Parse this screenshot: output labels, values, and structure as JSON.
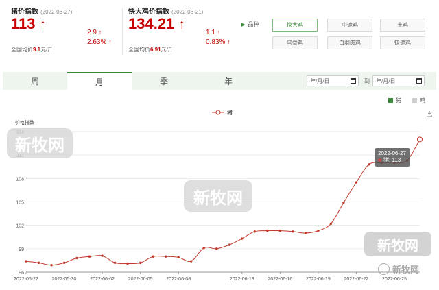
{
  "pig": {
    "title": "猪价指数",
    "date": "(2022-06-27)",
    "value": "113",
    "change_abs": "2.9",
    "change_pct": "2.63%",
    "national_label": "全国均价",
    "national_value": "9.1",
    "national_unit": "元/斤"
  },
  "chicken": {
    "title": "快大鸡价指数",
    "date": "(2022-06-21)",
    "value": "134.21",
    "change_abs": "1.1",
    "change_pct": "0.83%",
    "national_label": "全国均价",
    "national_value": "6.91",
    "national_unit": "元/斤"
  },
  "breed_label": "品种",
  "breeds": [
    "快大鸡",
    "中速鸡",
    "土鸡",
    "乌骨鸡",
    "白羽肉鸡",
    "快速鸡"
  ],
  "tabs": [
    "周",
    "月",
    "季",
    "年"
  ],
  "date_from_placeholder": "年/月/日",
  "date_to_label": "到",
  "date_to_placeholder": "年/月/日",
  "toggles": [
    {
      "label": "猪",
      "color": "#3c8a3c"
    },
    {
      "label": "鸡",
      "color": "#cccccc"
    }
  ],
  "watermark": "新牧网",
  "tooltip": {
    "date": "2022-06-27",
    "label": "猪: 113"
  },
  "chart_data": {
    "type": "line",
    "ylabel": "价格指数",
    "ylim": [
      96,
      114
    ],
    "yticks": [
      96,
      99,
      102,
      105,
      108,
      111,
      114
    ],
    "xticks": [
      "2022-05-27",
      "2022-05-30",
      "2022-06-02",
      "2022-06-05",
      "2022-06-08",
      "2022-06-13",
      "2022-06-16",
      "2022-06-19",
      "2022-06-22",
      "2022-06-25"
    ],
    "series": [
      {
        "name": "猪",
        "color": "#c0392b",
        "x": [
          "2022-05-27",
          "2022-05-28",
          "2022-05-29",
          "2022-05-30",
          "2022-05-31",
          "2022-06-01",
          "2022-06-02",
          "2022-06-03",
          "2022-06-04",
          "2022-06-05",
          "2022-06-06",
          "2022-06-07",
          "2022-06-08",
          "2022-06-09",
          "2022-06-10",
          "2022-06-11",
          "2022-06-12",
          "2022-06-13",
          "2022-06-14",
          "2022-06-15",
          "2022-06-16",
          "2022-06-17",
          "2022-06-18",
          "2022-06-19",
          "2022-06-20",
          "2022-06-21",
          "2022-06-22",
          "2022-06-23",
          "2022-06-24",
          "2022-06-25",
          "2022-06-26",
          "2022-06-27"
        ],
        "values": [
          97.4,
          97.2,
          96.9,
          97.2,
          97.8,
          98.0,
          98.1,
          97.2,
          97.1,
          97.2,
          98.0,
          98.0,
          97.9,
          97.4,
          99.1,
          99.0,
          99.5,
          100.3,
          101.2,
          101.3,
          101.3,
          101.2,
          101.0,
          101.3,
          102.2,
          104.9,
          107.5,
          109.8,
          110.0,
          110.0,
          110.3,
          113.0
        ]
      }
    ]
  }
}
